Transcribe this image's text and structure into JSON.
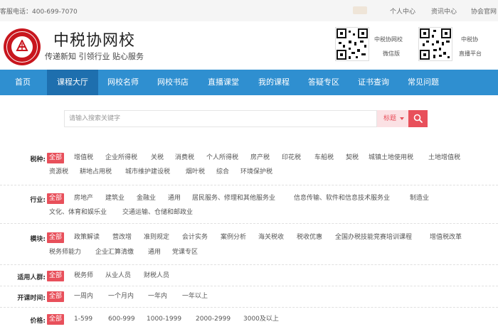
{
  "topbar": {
    "phone": "客服电话：400-699-7070",
    "links": [
      "个人中心",
      "资讯中心",
      "协会官网"
    ]
  },
  "header": {
    "title": "中税协网校",
    "slogan": "传递新知 引领行业 贴心服务",
    "qr_codes": [
      {
        "label_line1": "中税协网校",
        "label_line2": "微信版"
      },
      {
        "label_line1": "中税协",
        "label_line2": "直播平台"
      }
    ]
  },
  "nav": {
    "items": [
      "首页",
      "课程大厅",
      "网校名师",
      "网校书店",
      "直播课堂",
      "我的课程",
      "答疑专区",
      "证书查询",
      "常见问题"
    ],
    "active": "课程大厅"
  },
  "search": {
    "placeholder": "请输入搜索关键字",
    "value": "",
    "type_label": "标题"
  },
  "filters": [
    {
      "label": "税种:",
      "options": [
        "全部",
        "增值税",
        "企业所得税",
        "关税",
        "消费税",
        "个人所得税",
        "房产税",
        "印花税",
        "车船税",
        "契税",
        "城镇土地使用税",
        "土地增值税",
        "资源税",
        "耕地占用税",
        "城市维护建设税",
        "烟叶税",
        "综合",
        "环境保护税"
      ],
      "selected": "全部"
    },
    {
      "label": "行业:",
      "options": [
        "全部",
        "房地产",
        "建筑业",
        "金融业",
        "通用",
        "居民服务、修理和其他服务业",
        "信息传输、软件和信息技术服务业",
        "制造业",
        "文化、体育和娱乐业",
        "交通运输、仓储和邮政业"
      ],
      "selected": "全部"
    },
    {
      "label": "模块:",
      "options": [
        "全部",
        "政策解读",
        "营改增",
        "准则规定",
        "会计实务",
        "案例分析",
        "海关税收",
        "税收优惠",
        "全国办税技能竞赛培训课程",
        "增值税改革",
        "税务师能力",
        "企业汇算清缴",
        "通用",
        "党课专区"
      ],
      "selected": "全部"
    },
    {
      "label": "适用人群:",
      "options": [
        "全部",
        "税务师",
        "从业人员",
        "财税人员"
      ],
      "selected": "全部"
    },
    {
      "label": "开课时间:",
      "options": [
        "全部",
        "一周内",
        "一个月内",
        "一年内",
        "一年以上"
      ],
      "selected": "全部"
    },
    {
      "label": "价格:",
      "options": [
        "全部",
        "1-599",
        "600-999",
        "1000-1999",
        "2000-2999",
        "3000及以上"
      ],
      "selected": "全部"
    }
  ],
  "colors": {
    "nav_bg": "#2f8fd0",
    "nav_active": "#1e6fae",
    "accent": "#e8505b",
    "logo_red": "#c8161e"
  }
}
